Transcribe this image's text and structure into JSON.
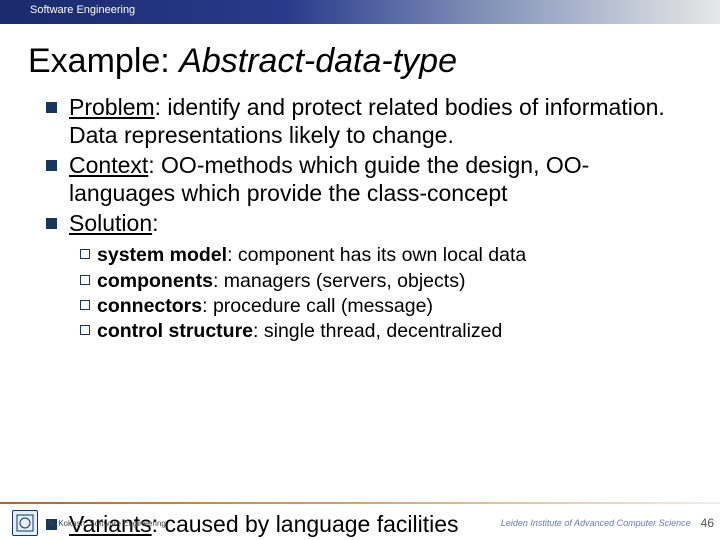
{
  "topbar": {
    "course": "Software Engineering"
  },
  "title": {
    "prefix": "Example: ",
    "emph": "Abstract-data-type"
  },
  "bullets": {
    "problem": {
      "label": "Problem",
      "text": ": identify and protect related bodies of information. Data representations likely to change."
    },
    "context": {
      "label": "Context",
      "text": ": OO-methods which guide the design, OO-languages which provide the class-concept"
    },
    "solution": {
      "label": "Solution",
      "text": ":"
    },
    "variants": {
      "label": "Variants",
      "text": ": caused by language facilities"
    }
  },
  "sub": {
    "system": {
      "bold": "system model",
      "text": ": component has its own local data"
    },
    "components": {
      "bold": "components",
      "text": ": managers (servers, objects)"
    },
    "connectors": {
      "bold": "connectors",
      "text": ": procedure call (message)"
    },
    "control": {
      "bold": "control structure",
      "text": ": single thread, decentralized"
    }
  },
  "footer": {
    "author": "N. Kokash, Software Engineering",
    "institute": "Leiden Institute of Advanced Computer Science",
    "page": "46"
  }
}
